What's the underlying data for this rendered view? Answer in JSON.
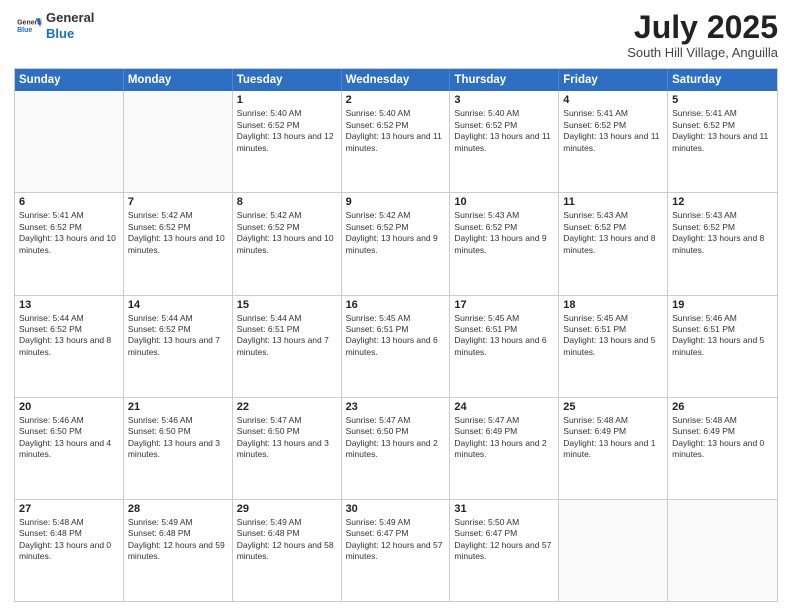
{
  "header": {
    "logo_general": "General",
    "logo_blue": "Blue",
    "month_year": "July 2025",
    "location": "South Hill Village, Anguilla"
  },
  "days_of_week": [
    "Sunday",
    "Monday",
    "Tuesday",
    "Wednesday",
    "Thursday",
    "Friday",
    "Saturday"
  ],
  "weeks": [
    [
      {
        "day": "",
        "text": ""
      },
      {
        "day": "",
        "text": ""
      },
      {
        "day": "1",
        "text": "Sunrise: 5:40 AM\nSunset: 6:52 PM\nDaylight: 13 hours and 12 minutes."
      },
      {
        "day": "2",
        "text": "Sunrise: 5:40 AM\nSunset: 6:52 PM\nDaylight: 13 hours and 11 minutes."
      },
      {
        "day": "3",
        "text": "Sunrise: 5:40 AM\nSunset: 6:52 PM\nDaylight: 13 hours and 11 minutes."
      },
      {
        "day": "4",
        "text": "Sunrise: 5:41 AM\nSunset: 6:52 PM\nDaylight: 13 hours and 11 minutes."
      },
      {
        "day": "5",
        "text": "Sunrise: 5:41 AM\nSunset: 6:52 PM\nDaylight: 13 hours and 11 minutes."
      }
    ],
    [
      {
        "day": "6",
        "text": "Sunrise: 5:41 AM\nSunset: 6:52 PM\nDaylight: 13 hours and 10 minutes."
      },
      {
        "day": "7",
        "text": "Sunrise: 5:42 AM\nSunset: 6:52 PM\nDaylight: 13 hours and 10 minutes."
      },
      {
        "day": "8",
        "text": "Sunrise: 5:42 AM\nSunset: 6:52 PM\nDaylight: 13 hours and 10 minutes."
      },
      {
        "day": "9",
        "text": "Sunrise: 5:42 AM\nSunset: 6:52 PM\nDaylight: 13 hours and 9 minutes."
      },
      {
        "day": "10",
        "text": "Sunrise: 5:43 AM\nSunset: 6:52 PM\nDaylight: 13 hours and 9 minutes."
      },
      {
        "day": "11",
        "text": "Sunrise: 5:43 AM\nSunset: 6:52 PM\nDaylight: 13 hours and 8 minutes."
      },
      {
        "day": "12",
        "text": "Sunrise: 5:43 AM\nSunset: 6:52 PM\nDaylight: 13 hours and 8 minutes."
      }
    ],
    [
      {
        "day": "13",
        "text": "Sunrise: 5:44 AM\nSunset: 6:52 PM\nDaylight: 13 hours and 8 minutes."
      },
      {
        "day": "14",
        "text": "Sunrise: 5:44 AM\nSunset: 6:52 PM\nDaylight: 13 hours and 7 minutes."
      },
      {
        "day": "15",
        "text": "Sunrise: 5:44 AM\nSunset: 6:51 PM\nDaylight: 13 hours and 7 minutes."
      },
      {
        "day": "16",
        "text": "Sunrise: 5:45 AM\nSunset: 6:51 PM\nDaylight: 13 hours and 6 minutes."
      },
      {
        "day": "17",
        "text": "Sunrise: 5:45 AM\nSunset: 6:51 PM\nDaylight: 13 hours and 6 minutes."
      },
      {
        "day": "18",
        "text": "Sunrise: 5:45 AM\nSunset: 6:51 PM\nDaylight: 13 hours and 5 minutes."
      },
      {
        "day": "19",
        "text": "Sunrise: 5:46 AM\nSunset: 6:51 PM\nDaylight: 13 hours and 5 minutes."
      }
    ],
    [
      {
        "day": "20",
        "text": "Sunrise: 5:46 AM\nSunset: 6:50 PM\nDaylight: 13 hours and 4 minutes."
      },
      {
        "day": "21",
        "text": "Sunrise: 5:46 AM\nSunset: 6:50 PM\nDaylight: 13 hours and 3 minutes."
      },
      {
        "day": "22",
        "text": "Sunrise: 5:47 AM\nSunset: 6:50 PM\nDaylight: 13 hours and 3 minutes."
      },
      {
        "day": "23",
        "text": "Sunrise: 5:47 AM\nSunset: 6:50 PM\nDaylight: 13 hours and 2 minutes."
      },
      {
        "day": "24",
        "text": "Sunrise: 5:47 AM\nSunset: 6:49 PM\nDaylight: 13 hours and 2 minutes."
      },
      {
        "day": "25",
        "text": "Sunrise: 5:48 AM\nSunset: 6:49 PM\nDaylight: 13 hours and 1 minute."
      },
      {
        "day": "26",
        "text": "Sunrise: 5:48 AM\nSunset: 6:49 PM\nDaylight: 13 hours and 0 minutes."
      }
    ],
    [
      {
        "day": "27",
        "text": "Sunrise: 5:48 AM\nSunset: 6:48 PM\nDaylight: 13 hours and 0 minutes."
      },
      {
        "day": "28",
        "text": "Sunrise: 5:49 AM\nSunset: 6:48 PM\nDaylight: 12 hours and 59 minutes."
      },
      {
        "day": "29",
        "text": "Sunrise: 5:49 AM\nSunset: 6:48 PM\nDaylight: 12 hours and 58 minutes."
      },
      {
        "day": "30",
        "text": "Sunrise: 5:49 AM\nSunset: 6:47 PM\nDaylight: 12 hours and 57 minutes."
      },
      {
        "day": "31",
        "text": "Sunrise: 5:50 AM\nSunset: 6:47 PM\nDaylight: 12 hours and 57 minutes."
      },
      {
        "day": "",
        "text": ""
      },
      {
        "day": "",
        "text": ""
      }
    ]
  ]
}
